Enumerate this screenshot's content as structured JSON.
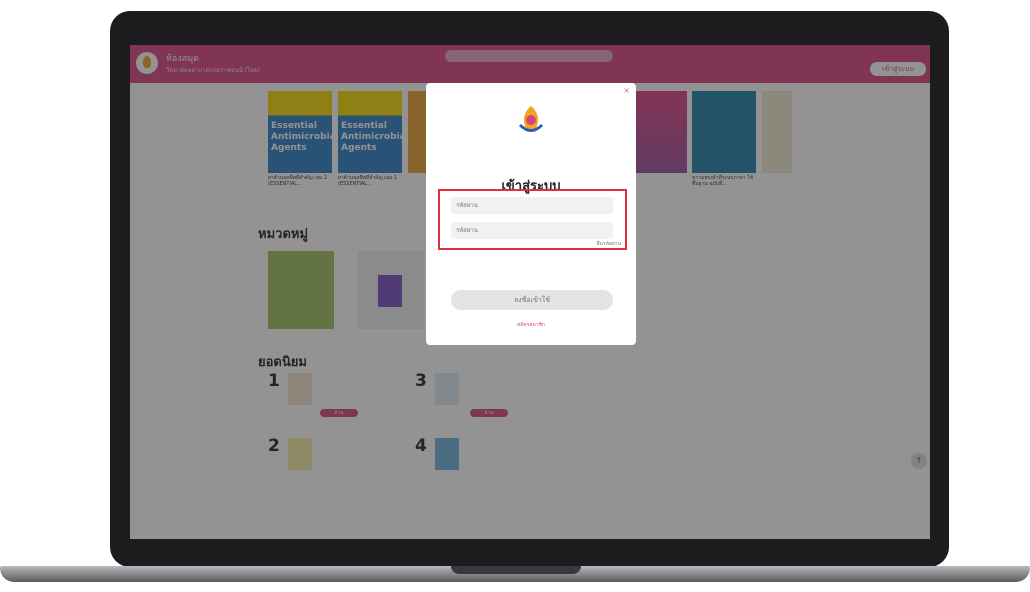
{
  "header": {
    "site_title": "ห้องสมุด",
    "site_subtitle": "วิทยาลัยพยาบาลบรมราชชนนี (ไทย)",
    "nav_tabs": [
      "",
      ""
    ],
    "login_button": "เข้าสู่ระบบ"
  },
  "books": [
    {
      "title": "Essential Antimicrobial Agents",
      "caption": "ยาต้านจุลชีพที่สำคัญ เล่ม 2 (ESSENTIAL...",
      "cover_color": "#2a7fc4"
    },
    {
      "title": "Essential Antimicrobial Agents",
      "caption": "ยาต้านจุลชีพที่สำคัญ เล่ม 1 (ESSENTIAL...",
      "cover_color": "#2a7fc4"
    },
    {
      "title": "",
      "caption": "",
      "cover_color": "#e8a030"
    },
    {
      "title": "",
      "caption": "",
      "cover_color": "#9b4fa0"
    },
    {
      "title": "",
      "caption": "ความทรงจำที่ระบบภาษา ไข้ พื้นฐาน ฉบับที่...",
      "cover_color": "#1f7fa6"
    },
    {
      "title": "",
      "caption": "",
      "cover_color": "#f2e8d0"
    }
  ],
  "categories_title": "หมวดหมู่",
  "categories": [
    {
      "label": "",
      "color": "#9fbf5a"
    },
    {
      "label": "",
      "color": "#7a4fc4"
    }
  ],
  "popular_title": "ยอดนิยม",
  "popular": [
    {
      "rank": "1",
      "title": "",
      "read_label": "อ่าน"
    },
    {
      "rank": "3",
      "title": "",
      "read_label": "อ่าน"
    },
    {
      "rank": "2",
      "title": ""
    },
    {
      "rank": "4",
      "title": ""
    }
  ],
  "scroll_top_icon": "↑",
  "modal": {
    "close_icon": "×",
    "title": "เข้าสู่ระบบ",
    "username_placeholder": "รหัสผ่าน",
    "password_placeholder": "รหัสผ่าน",
    "forgot_password": "ลืมรหัสผ่าน",
    "submit_button": "ลงชื่อเข้าใช้",
    "register_link": "สมัครสมาชิก"
  }
}
